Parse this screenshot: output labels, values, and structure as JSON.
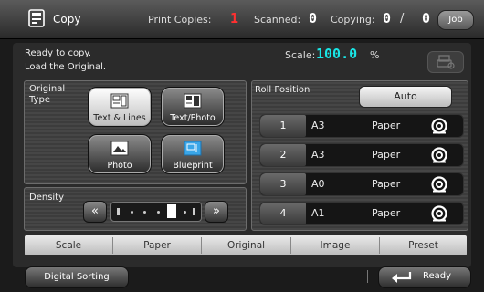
{
  "header": {
    "title": "Copy",
    "print_copies_label": "Print Copies:",
    "print_copies_value": "1",
    "scanned_label": "Scanned:",
    "scanned_value": "0",
    "copying_label": "Copying:",
    "copying_value": "0",
    "copying_separator": "/",
    "copying_total": "0",
    "job_button": "Job",
    "icon": "copy-machine-icon"
  },
  "status": {
    "line1": "Ready to copy.",
    "line2": "Load the Original.",
    "scale_label": "Scale:",
    "scale_value": "100.0",
    "scale_unit": "%"
  },
  "original_type": {
    "label_line1": "Original",
    "label_line2": "Type",
    "buttons": [
      {
        "label": "Text & Lines",
        "selected": true,
        "icon": "text-lines-icon"
      },
      {
        "label": "Text/Photo",
        "selected": false,
        "icon": "text-photo-icon"
      },
      {
        "label": "Photo",
        "selected": false,
        "icon": "photo-icon"
      },
      {
        "label": "Blueprint",
        "selected": false,
        "icon": "blueprint-icon"
      }
    ]
  },
  "density": {
    "label": "Density",
    "left_arrow": "«",
    "right_arrow": "»",
    "level": 5,
    "steps": 7
  },
  "roll_position": {
    "label": "Roll Position",
    "auto_button": "Auto",
    "rolls": [
      {
        "number": "1",
        "size": "A3",
        "media": "Paper"
      },
      {
        "number": "2",
        "size": "A3",
        "media": "Paper"
      },
      {
        "number": "3",
        "size": "A0",
        "media": "Paper"
      },
      {
        "number": "4",
        "size": "A1",
        "media": "Paper"
      }
    ]
  },
  "tabs": [
    "Scale",
    "Paper",
    "Original",
    "Image",
    "Preset"
  ],
  "footer": {
    "digital_sorting": "Digital Sorting",
    "ready": "Ready"
  },
  "colors": {
    "segment_red": "#ff3030",
    "segment_white": "#ffffff",
    "scale_cyan": "#19e6e6"
  }
}
